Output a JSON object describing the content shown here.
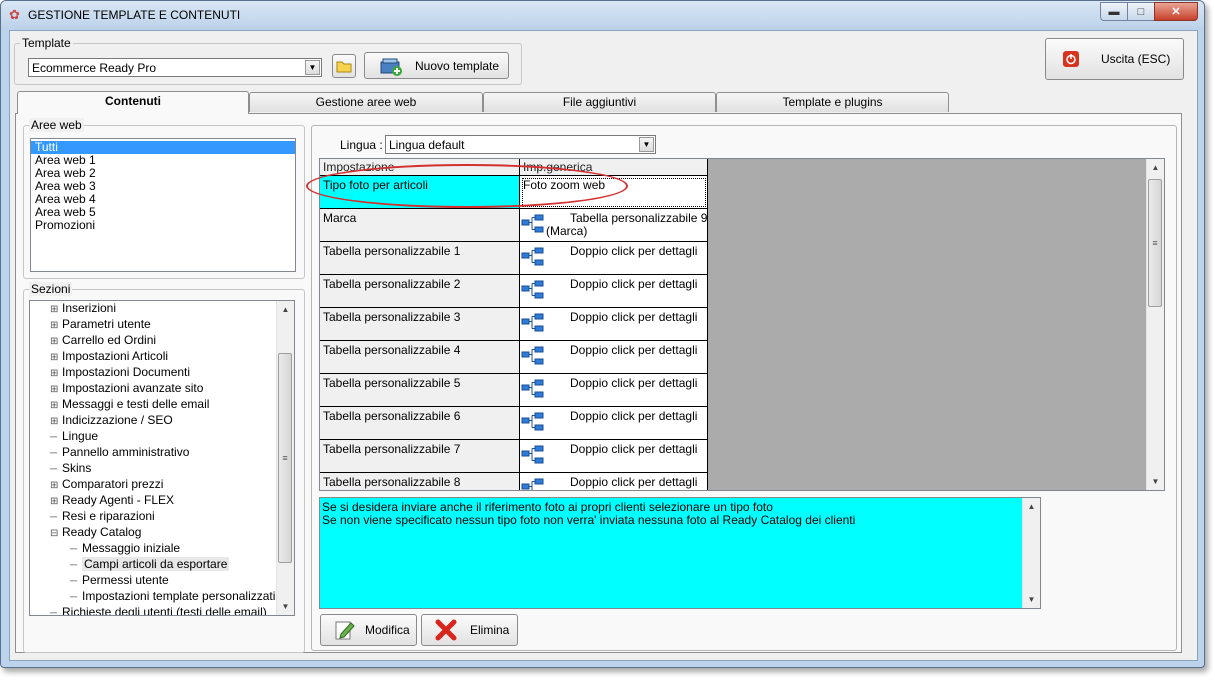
{
  "window": {
    "title": "GESTIONE TEMPLATE E CONTENUTI"
  },
  "template": {
    "legend": "Template",
    "selected": "Ecommerce Ready Pro",
    "new_label": "Nuovo template"
  },
  "exit_label": "Uscita (ESC)",
  "tabs": [
    "Contenuti",
    "Gestione aree web",
    "File aggiuntivi",
    "Template e plugins"
  ],
  "aree_web": {
    "legend": "Aree web",
    "items": [
      "Tutti",
      "Area web 1",
      "Area web 2",
      "Area web 3",
      "Area web 4",
      "Area web 5",
      "Promozioni"
    ]
  },
  "sezioni": {
    "legend": "Sezioni",
    "items": [
      {
        "label": "Inserizioni",
        "expand": true
      },
      {
        "label": "Parametri utente",
        "expand": true
      },
      {
        "label": "Carrello ed Ordini",
        "expand": true
      },
      {
        "label": "Impostazioni Articoli",
        "expand": true
      },
      {
        "label": "Impostazioni Documenti",
        "expand": true
      },
      {
        "label": "Impostazioni avanzate sito",
        "expand": true
      },
      {
        "label": "Messaggi e testi delle email",
        "expand": true
      },
      {
        "label": "Indicizzazione / SEO",
        "expand": true
      },
      {
        "label": "Lingue",
        "expand": false
      },
      {
        "label": "Pannello amministrativo",
        "expand": false
      },
      {
        "label": "Skins",
        "expand": false
      },
      {
        "label": "Comparatori prezzi",
        "expand": true
      },
      {
        "label": "Ready Agenti - FLEX",
        "expand": true
      },
      {
        "label": "Resi e riparazioni",
        "expand": false
      },
      {
        "label": "Ready Catalog",
        "expand": "open"
      },
      {
        "label": "Messaggio iniziale",
        "child": true
      },
      {
        "label": "Campi articoli da esportare",
        "child": true,
        "selected": true
      },
      {
        "label": "Permessi utente",
        "child": true
      },
      {
        "label": "Impostazioni template personalizzati",
        "child": true
      },
      {
        "label": "Richieste degli utenti (testi delle email)",
        "expand": false
      }
    ]
  },
  "lingua": {
    "label": "Lingua :",
    "selected": "Lingua default"
  },
  "grid": {
    "headers": [
      "Impostazione",
      "Imp.generica"
    ],
    "rows": [
      {
        "name": "Tipo foto per articoli",
        "value": "Foto zoom web",
        "tree": false
      },
      {
        "name": "Marca",
        "value": "Tabella personalizzabile 9",
        "value2": "(Marca)",
        "tree": true
      },
      {
        "name": "Tabella personalizzabile 1",
        "value": "Doppio click per dettagli",
        "tree": true
      },
      {
        "name": "Tabella personalizzabile 2",
        "value": "Doppio click per dettagli",
        "tree": true
      },
      {
        "name": "Tabella personalizzabile 3",
        "value": "Doppio click per dettagli",
        "tree": true
      },
      {
        "name": "Tabella personalizzabile 4",
        "value": "Doppio click per dettagli",
        "tree": true
      },
      {
        "name": "Tabella personalizzabile 5",
        "value": "Doppio click per dettagli",
        "tree": true
      },
      {
        "name": "Tabella personalizzabile 6",
        "value": "Doppio click per dettagli",
        "tree": true
      },
      {
        "name": "Tabella personalizzabile 7",
        "value": "Doppio click per dettagli",
        "tree": true
      },
      {
        "name": "Tabella personalizzabile 8",
        "value": "Doppio click per dettagli",
        "tree": true
      }
    ]
  },
  "description": {
    "line1": "Se si desidera inviare anche il riferimento foto ai propri clienti selezionare un tipo foto",
    "line2": "Se non viene specificato nessun tipo foto non verra' inviata nessuna foto al Ready Catalog dei clienti"
  },
  "buttons": {
    "modifica": "Modifica",
    "elimina": "Elimina"
  },
  "icons": {
    "app": "app-icon",
    "folder": "folder-icon",
    "new_template": "new-template-icon",
    "exit": "power-icon",
    "tree": "tree-structure-icon",
    "edit": "edit-icon",
    "delete": "delete-icon"
  },
  "colors": {
    "highlight": "#00ffff",
    "selection": "#3399ff",
    "annotation": "#d32f2f"
  }
}
